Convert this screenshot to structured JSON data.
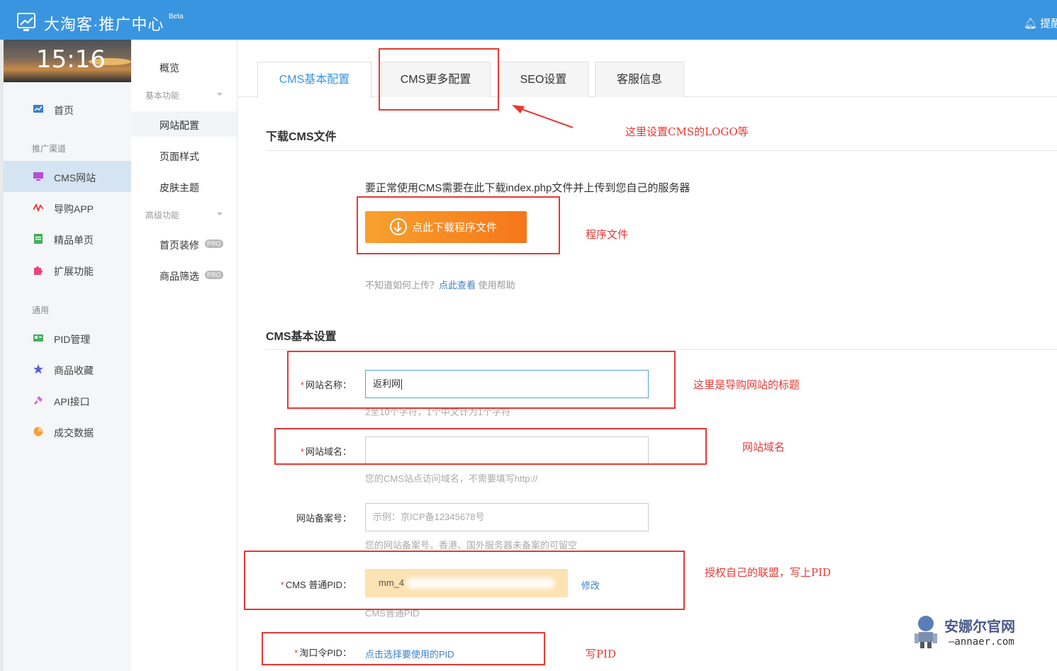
{
  "header": {
    "title": "大淘客·推广中心",
    "beta": "Beta",
    "remind": "提醒",
    "brand_color": "#3a95e0"
  },
  "clock": "15:16",
  "sidebar": {
    "home": "首页",
    "group_channel": "推广渠道",
    "cms": "CMS网站",
    "app": "导购APP",
    "single": "精品单页",
    "ext": "扩展功能",
    "group_common": "通用",
    "pid": "PID管理",
    "fav": "商品收藏",
    "api": "API接口",
    "deal": "成交数据"
  },
  "subnav": {
    "overview": "概览",
    "group_basic": "基本功能",
    "site_config": "网站配置",
    "page_style": "页面样式",
    "skin": "皮肤主题",
    "group_adv": "高级功能",
    "home_decor": "首页装修",
    "filter": "商品筛选",
    "pro": "PRO"
  },
  "tabs": {
    "basic": "CMS基本配置",
    "more": "CMS更多配置",
    "seo": "SEO设置",
    "service": "客服信息"
  },
  "download": {
    "title": "下载CMS文件",
    "notice": "要正常使用CMS需要在此下载index.php文件并上传到您自己的服务器",
    "button": "点此下载程序文件",
    "help_prefix": "不知道如何上传？",
    "help_link": "点此查看",
    "help_suffix": " 使用帮助"
  },
  "basic": {
    "title": "CMS基本设置",
    "site_name_label": "网站名称：",
    "site_name_value": "返利网",
    "site_name_hint": "2至10个字符，1个中文计为1个字符",
    "domain_label": "网站域名：",
    "domain_value": "",
    "domain_hint": "您的CMS站点访问域名，不需要填写http://",
    "icp_label": "网站备案号：",
    "icp_placeholder": "示例：京ICP备12345678号",
    "icp_hint": "您的网站备案号。香港、国外服务器未备案的可留空",
    "pid_label": "CMS 普通PID：",
    "pid_value": "mm_4",
    "pid_edit": "修改",
    "pid_hint": "CMS普通PID",
    "tkl_label": "淘口令PID：",
    "tkl_link": "点击选择要使用的PID",
    "required_mark": "*"
  },
  "annotations": {
    "logo": "这里设置CMS的LOGO等",
    "program": "程序文件",
    "title": "这里是导购网站的标题",
    "domain": "网站域名",
    "pid": "授权自己的联盟，写上PID",
    "write_pid": "写PID"
  },
  "watermark": {
    "name": "安娜尔官网",
    "url": "—annaer.com"
  }
}
